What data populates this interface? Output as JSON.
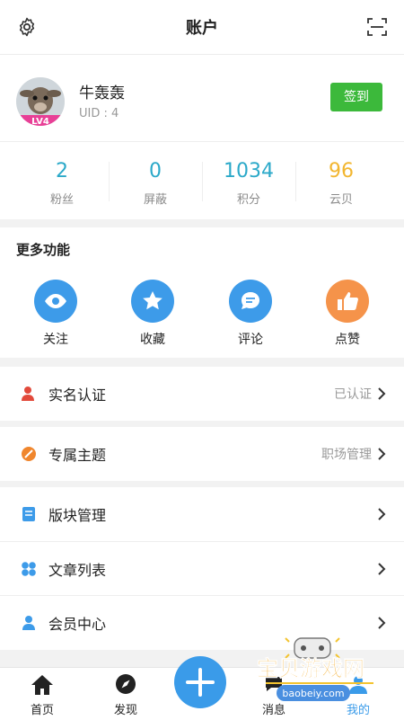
{
  "header": {
    "title": "账户",
    "settings_icon": "gear-icon",
    "scan_icon": "scan-icon"
  },
  "profile": {
    "name": "牛轰轰",
    "uid": "UID : 4",
    "level_badge": "LV4",
    "signin_label": "签到"
  },
  "stats": [
    {
      "value": "2",
      "label": "粉丝",
      "color": "#2ba9c9"
    },
    {
      "value": "0",
      "label": "屏蔽",
      "color": "#2ba9c9"
    },
    {
      "value": "1034",
      "label": "积分",
      "color": "#2ba9c9"
    },
    {
      "value": "96",
      "label": "云贝",
      "color": "#f2b630"
    }
  ],
  "more": {
    "title": "更多功能",
    "items": [
      {
        "label": "关注",
        "icon": "eye-icon",
        "color": "#3d9be9"
      },
      {
        "label": "收藏",
        "icon": "star-icon",
        "color": "#3d9be9"
      },
      {
        "label": "评论",
        "icon": "comment-icon",
        "color": "#3d9be9"
      },
      {
        "label": "点赞",
        "icon": "thumbs-up-icon",
        "color": "#f5934a"
      }
    ]
  },
  "rows": [
    {
      "label": "实名认证",
      "value": "已认证",
      "icon": "user-verify-icon",
      "color": "#e24a3b"
    },
    {
      "label": "专属主题",
      "value": "职场管理",
      "icon": "theme-icon",
      "color": "#f0862d"
    },
    {
      "label": "版块管理",
      "value": "",
      "icon": "board-icon",
      "color": "#3d9be9"
    },
    {
      "label": "文章列表",
      "value": "",
      "icon": "grid-icon",
      "color": "#3d9be9"
    },
    {
      "label": "会员中心",
      "value": "",
      "icon": "member-icon",
      "color": "#3d9be9"
    }
  ],
  "tabs": [
    {
      "label": "首页",
      "icon": "home-icon"
    },
    {
      "label": "发现",
      "icon": "compass-icon"
    },
    {
      "label": "消息",
      "icon": "message-icon"
    },
    {
      "label": "我的",
      "icon": "profile-icon",
      "active": true
    }
  ],
  "watermark": {
    "text": "宝贝游戏网",
    "url": "baobeiy.com"
  },
  "colors": {
    "accent": "#3a9be9",
    "signin": "#3cb93b"
  }
}
